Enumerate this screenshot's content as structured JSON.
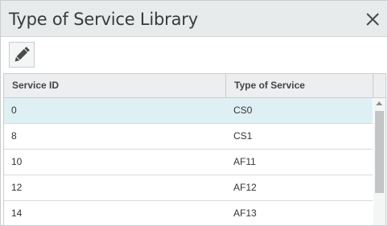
{
  "dialog": {
    "title": "Type of Service Library",
    "close_icon": "close-icon",
    "edit_icon": "pencil-icon"
  },
  "grid": {
    "columns": [
      "Service ID",
      "Type of Service"
    ],
    "rows": [
      {
        "service_id": "0",
        "type_of_service": "CS0"
      },
      {
        "service_id": "8",
        "type_of_service": "CS1"
      },
      {
        "service_id": "10",
        "type_of_service": "AF11"
      },
      {
        "service_id": "12",
        "type_of_service": "AF12"
      },
      {
        "service_id": "14",
        "type_of_service": "AF13"
      }
    ],
    "selected_row": 0
  },
  "colors": {
    "selected_row": "#dff0f5",
    "header_bg": "#eceef0",
    "titlebar_bg": "#e8ebec"
  }
}
